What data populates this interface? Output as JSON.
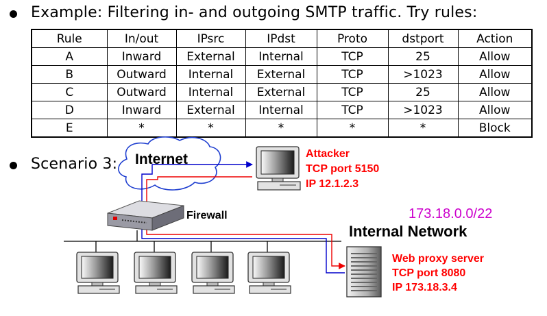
{
  "example": {
    "text": "Example: Filtering in- and outgoing SMTP traffic.  Try rules:"
  },
  "rules_table": {
    "headers": [
      "Rule",
      "In/out",
      "IPsrc",
      "IPdst",
      "Proto",
      "dstport",
      "Action"
    ],
    "rows": [
      [
        "A",
        "Inward",
        "External",
        "Internal",
        "TCP",
        "25",
        "Allow"
      ],
      [
        "B",
        "Outward",
        "Internal",
        "External",
        "TCP",
        ">1023",
        "Allow"
      ],
      [
        "C",
        "Outward",
        "Internal",
        "External",
        "TCP",
        "25",
        "Allow"
      ],
      [
        "D",
        "Inward",
        "External",
        "Internal",
        "TCP",
        ">1023",
        "Allow"
      ],
      [
        "E",
        "*",
        "*",
        "*",
        "*",
        "*",
        "Block"
      ]
    ]
  },
  "scenario": {
    "text": "Scenario 3:"
  },
  "diagram": {
    "internet_label": "Internet",
    "firewall_label": "Firewall",
    "internal_network_label": "Internal Network",
    "subnet_label": "173.18.0.0/22",
    "attacker": [
      "Attacker",
      "TCP port 5150",
      "IP 12.1.2.3"
    ],
    "proxy": [
      "Web proxy server",
      "TCP port 8080",
      "IP 173.18.3.4"
    ],
    "colors": {
      "red_text": "#ff0000",
      "subnet_text": "#cc00cc",
      "blue_line": "#0000cc",
      "red_line": "#ee0000",
      "cloud_stroke": "#1f3fd0"
    }
  }
}
